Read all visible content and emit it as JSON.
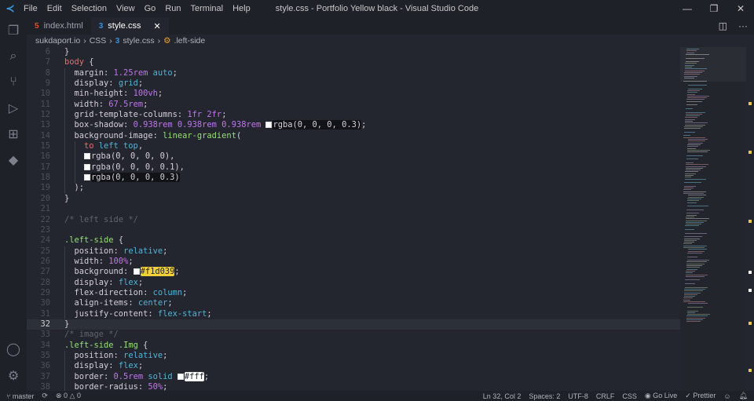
{
  "window": {
    "title": "style.css - Portfolio Yellow black - Visual Studio Code"
  },
  "menu": [
    "File",
    "Edit",
    "Selection",
    "View",
    "Go",
    "Run",
    "Terminal",
    "Help"
  ],
  "tabs": [
    {
      "label": "index.html",
      "icon": "html-icon"
    },
    {
      "label": "style.css",
      "icon": "css-icon",
      "close": "✕"
    }
  ],
  "breadcrumb": [
    "sukdaport.io",
    "CSS",
    "style.css",
    ".left-side"
  ],
  "colors": {
    "accent": "#3a9be3",
    "swatch_yellow": "#f1d039",
    "bg": "#23262e"
  },
  "editor": {
    "current_line": 32,
    "lines": [
      {
        "n": "6",
        "i": 0,
        "t": [
          [
            "}",
            "p"
          ]
        ]
      },
      {
        "n": "7",
        "i": 0,
        "t": [
          [
            "body",
            "b"
          ],
          [
            " {",
            "p"
          ]
        ]
      },
      {
        "n": "8",
        "i": 1,
        "t": [
          [
            "margin: ",
            "pr"
          ],
          [
            "1.25rem",
            "n"
          ],
          [
            " auto",
            "k"
          ],
          [
            ";",
            "p"
          ]
        ]
      },
      {
        "n": "9",
        "i": 1,
        "t": [
          [
            "display: ",
            "pr"
          ],
          [
            "grid",
            "k"
          ],
          [
            ";",
            "p"
          ]
        ]
      },
      {
        "n": "10",
        "i": 1,
        "t": [
          [
            "min-height: ",
            "pr"
          ],
          [
            "100vh",
            "n"
          ],
          [
            ";",
            "p"
          ]
        ]
      },
      {
        "n": "11",
        "i": 1,
        "t": [
          [
            "width: ",
            "pr"
          ],
          [
            "67.5rem",
            "n"
          ],
          [
            ";",
            "p"
          ]
        ]
      },
      {
        "n": "12",
        "i": 1,
        "t": [
          [
            "grid-template-columns: ",
            "pr"
          ],
          [
            "1fr 2fr",
            "n"
          ],
          [
            ";",
            "p"
          ]
        ]
      },
      {
        "n": "13",
        "i": 1,
        "t": [
          [
            "box-shadow: ",
            "pr"
          ],
          [
            "0.938rem 0.938rem 0.938rem ",
            "n"
          ],
          [
            "",
            "sw"
          ],
          [
            "rgba(0, 0, 0, 0.3)",
            "p hl"
          ],
          [
            ";",
            "p"
          ]
        ]
      },
      {
        "n": "14",
        "i": 1,
        "t": [
          [
            "background-image: ",
            "pr"
          ],
          [
            "linear-gradient",
            "f"
          ],
          [
            "(",
            "p"
          ]
        ]
      },
      {
        "n": "15",
        "i": 2,
        "t": [
          [
            "to",
            "to"
          ],
          [
            " left top",
            "k"
          ],
          [
            ",",
            "p"
          ]
        ]
      },
      {
        "n": "16",
        "i": 2,
        "t": [
          [
            "",
            "sw"
          ],
          [
            "rgba(0, 0, 0, 0)",
            "p"
          ],
          [
            ",",
            "p"
          ]
        ]
      },
      {
        "n": "17",
        "i": 2,
        "t": [
          [
            "",
            "sw"
          ],
          [
            "rgba(0, 0, 0, 0.1)",
            "p"
          ],
          [
            ",",
            "p"
          ]
        ]
      },
      {
        "n": "18",
        "i": 2,
        "t": [
          [
            "",
            "sw"
          ],
          [
            "rgba(0, 0, 0, 0.3)",
            "p hl"
          ]
        ]
      },
      {
        "n": "19",
        "i": 1,
        "t": [
          [
            ");",
            "p"
          ]
        ]
      },
      {
        "n": "20",
        "i": 0,
        "t": [
          [
            "}",
            "p"
          ]
        ]
      },
      {
        "n": "21",
        "i": 0,
        "t": []
      },
      {
        "n": "22",
        "i": 0,
        "t": [
          [
            "/* left side */",
            "cm"
          ]
        ]
      },
      {
        "n": "23",
        "i": 0,
        "t": []
      },
      {
        "n": "24",
        "i": 0,
        "t": [
          [
            ".left-side",
            "s"
          ],
          [
            " {",
            "p"
          ]
        ]
      },
      {
        "n": "25",
        "i": 1,
        "t": [
          [
            "position: ",
            "pr"
          ],
          [
            "relative",
            "k"
          ],
          [
            ";",
            "p"
          ]
        ]
      },
      {
        "n": "26",
        "i": 1,
        "t": [
          [
            "width: ",
            "pr"
          ],
          [
            "100%",
            "n"
          ],
          [
            ";",
            "p"
          ]
        ]
      },
      {
        "n": "27",
        "i": 1,
        "t": [
          [
            "background: ",
            "pr"
          ],
          [
            "",
            "sw y"
          ],
          [
            "#f1d039",
            "hly"
          ],
          [
            ";",
            "p"
          ]
        ]
      },
      {
        "n": "28",
        "i": 1,
        "t": [
          [
            "display: ",
            "pr"
          ],
          [
            "flex",
            "k"
          ],
          [
            ";",
            "p"
          ]
        ]
      },
      {
        "n": "29",
        "i": 1,
        "t": [
          [
            "flex-direction: ",
            "pr"
          ],
          [
            "column",
            "k"
          ],
          [
            ";",
            "p"
          ]
        ]
      },
      {
        "n": "30",
        "i": 1,
        "t": [
          [
            "align-items: ",
            "pr"
          ],
          [
            "center",
            "k"
          ],
          [
            ";",
            "p"
          ]
        ]
      },
      {
        "n": "31",
        "i": 1,
        "t": [
          [
            "justify-content: ",
            "pr"
          ],
          [
            "flex-start",
            "k"
          ],
          [
            ";",
            "p"
          ]
        ]
      },
      {
        "n": "32",
        "i": 0,
        "t": [
          [
            "}",
            "p"
          ]
        ]
      },
      {
        "n": "33",
        "i": 0,
        "t": [
          [
            "/* image */",
            "cm"
          ]
        ]
      },
      {
        "n": "34",
        "i": 0,
        "t": [
          [
            ".left-side .Img",
            "s"
          ],
          [
            " {",
            "p"
          ]
        ]
      },
      {
        "n": "35",
        "i": 1,
        "t": [
          [
            "position: ",
            "pr"
          ],
          [
            "relative",
            "k"
          ],
          [
            ";",
            "p"
          ]
        ]
      },
      {
        "n": "36",
        "i": 1,
        "t": [
          [
            "display: ",
            "pr"
          ],
          [
            "flex",
            "k"
          ],
          [
            ";",
            "p"
          ]
        ]
      },
      {
        "n": "37",
        "i": 1,
        "t": [
          [
            "border: ",
            "pr"
          ],
          [
            "0.5rem",
            "n"
          ],
          [
            " solid ",
            "k"
          ],
          [
            "",
            "sw w"
          ],
          [
            "#fff",
            "hlw"
          ],
          [
            ";",
            "p"
          ]
        ]
      },
      {
        "n": "38",
        "i": 1,
        "t": [
          [
            "border-radius: ",
            "pr"
          ],
          [
            "50%",
            "n"
          ],
          [
            ";",
            "p"
          ]
        ]
      }
    ]
  },
  "status": {
    "branch": "master",
    "sync": "⟳",
    "errors": "0",
    "warnings": "0",
    "position": "Ln 32, Col 2",
    "spaces": "Spaces: 2",
    "encoding": "UTF-8",
    "eol": "CRLF",
    "language": "CSS",
    "golive": "Go Live",
    "prettier": "Prettier"
  }
}
